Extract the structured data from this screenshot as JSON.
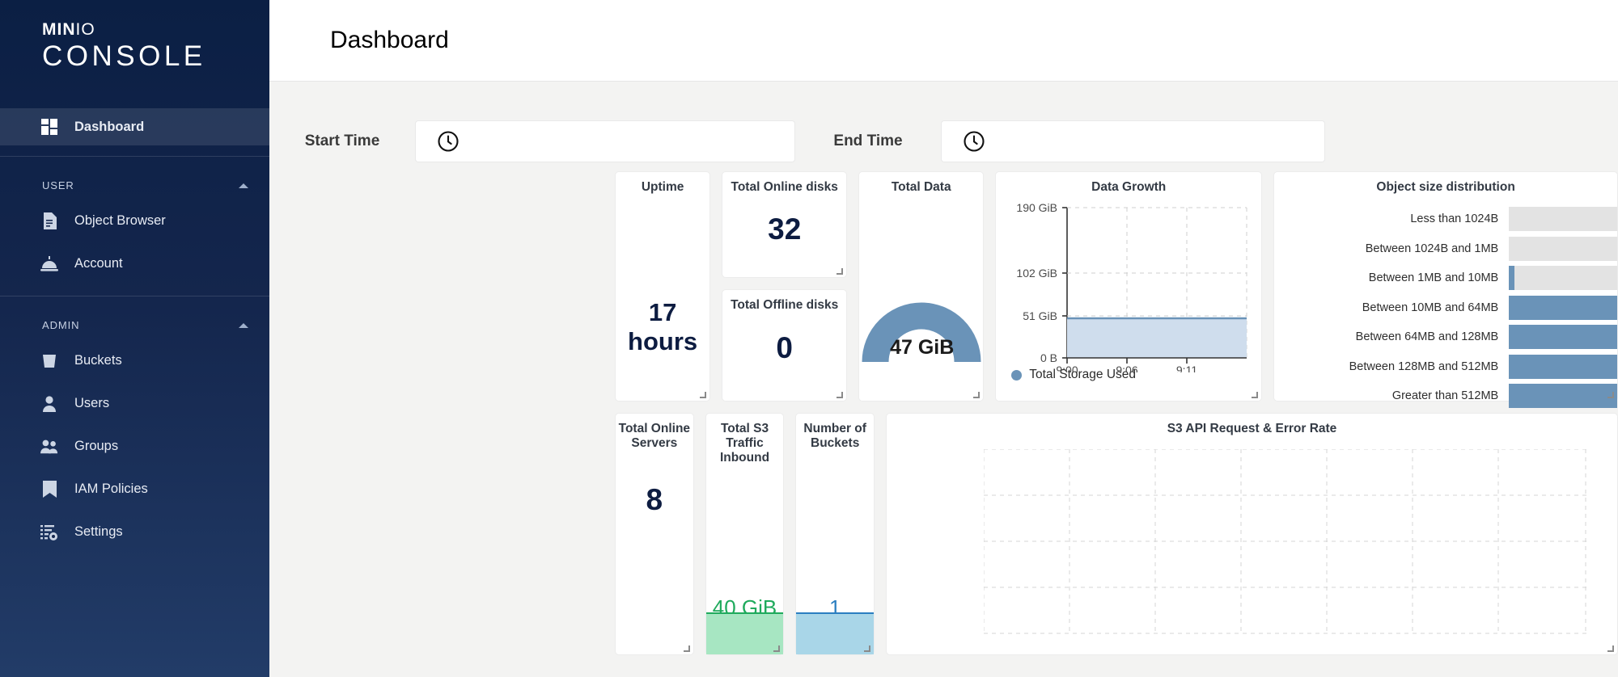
{
  "sidebar": {
    "brand": {
      "minio": "MIN",
      "io": "IO",
      "console": "CONSOLE"
    },
    "primary": [
      {
        "label": "Dashboard",
        "icon": "dashboard-icon",
        "active": true
      }
    ],
    "groups": [
      {
        "label": "USER",
        "items": [
          {
            "label": "Object Browser",
            "icon": "document-icon"
          },
          {
            "label": "Account",
            "icon": "bell-service-icon"
          }
        ]
      },
      {
        "label": "ADMIN",
        "items": [
          {
            "label": "Buckets",
            "icon": "bucket-icon"
          },
          {
            "label": "Users",
            "icon": "user-icon"
          },
          {
            "label": "Groups",
            "icon": "groups-icon"
          },
          {
            "label": "IAM Policies",
            "icon": "bookmark-icon"
          },
          {
            "label": "Settings",
            "icon": "settings-icon"
          }
        ]
      }
    ]
  },
  "header": {
    "title": "Dashboard"
  },
  "filters": {
    "start_label": "Start Time",
    "start_value": "",
    "start_placeholder": "",
    "end_label": "End Time",
    "end_value": "",
    "end_placeholder": "",
    "clock_icon": "clock-icon"
  },
  "widgets": {
    "uptime": {
      "title": "Uptime",
      "value": "17 hours"
    },
    "online_disks": {
      "title": "Total Online disks",
      "value": "32"
    },
    "offline_disks": {
      "title": "Total Offline disks",
      "value": "0"
    },
    "total_data": {
      "title": "Total Data",
      "value": "47 GiB"
    },
    "online_servers": {
      "title": "Total Online Servers",
      "value": "8"
    },
    "s3_inbound": {
      "title": "Total S3 Traffic Inbound",
      "value": "40 GiB"
    },
    "num_buckets": {
      "title": "Number of Buckets",
      "value": "1"
    },
    "s3_api": {
      "title": "S3 API Request & Error Rate"
    }
  },
  "colors": {
    "accent_blue": "#6a93b8",
    "navy": "#0d1c41",
    "green": "#1faa5c",
    "light_blue": "#2a7ec0",
    "bar_track": "#e3e3e3",
    "sidebar_top": "#0b1f44"
  },
  "chart_data": [
    {
      "type": "area",
      "title": "Data Growth",
      "xlabel": "",
      "ylabel": "",
      "x": [
        "9:00",
        "9:06",
        "9:11"
      ],
      "ytick_labels": [
        "190 GiB",
        "102 GiB",
        "51 GiB",
        "0 B"
      ],
      "ylim": [
        0,
        190
      ],
      "grid": true,
      "legend": [
        "Total Storage Used"
      ],
      "legend_position": "bottom-left",
      "series": [
        {
          "name": "Total Storage Used",
          "values": [
            47,
            47,
            47
          ],
          "color": "#6a93b8"
        }
      ]
    },
    {
      "type": "bar",
      "title": "Object size distribution",
      "orientation": "horizontal",
      "categories": [
        "Less than 1024B",
        "Between 1024B and 1MB",
        "Between 1MB and 10MB",
        "Between 10MB and 64MB",
        "Between 64MB and 128MB",
        "Between 128MB and 512MB",
        "Greater than 512MB"
      ],
      "values": [
        0,
        0,
        5,
        100,
        100,
        100,
        100
      ],
      "max": 100,
      "xlabel": "",
      "ylabel": "",
      "grid": false,
      "color": "#6a93b8",
      "track_color": "#e3e3e3"
    },
    {
      "type": "line",
      "title": "S3 API Request & Error Rate",
      "x": [],
      "series": [],
      "grid": true,
      "xlabel": "",
      "ylabel": ""
    },
    {
      "type": "area",
      "title": "Total S3 Traffic Inbound",
      "values": [
        40
      ],
      "value_label": "40 GiB",
      "color": "#1faa5c"
    },
    {
      "type": "area",
      "title": "Number of Buckets",
      "values": [
        1
      ],
      "value_label": "1",
      "color": "#2a7ec0"
    },
    {
      "type": "gauge",
      "title": "Total Data",
      "value": 47,
      "value_label": "47 GiB",
      "color": "#6a93b8"
    }
  ]
}
